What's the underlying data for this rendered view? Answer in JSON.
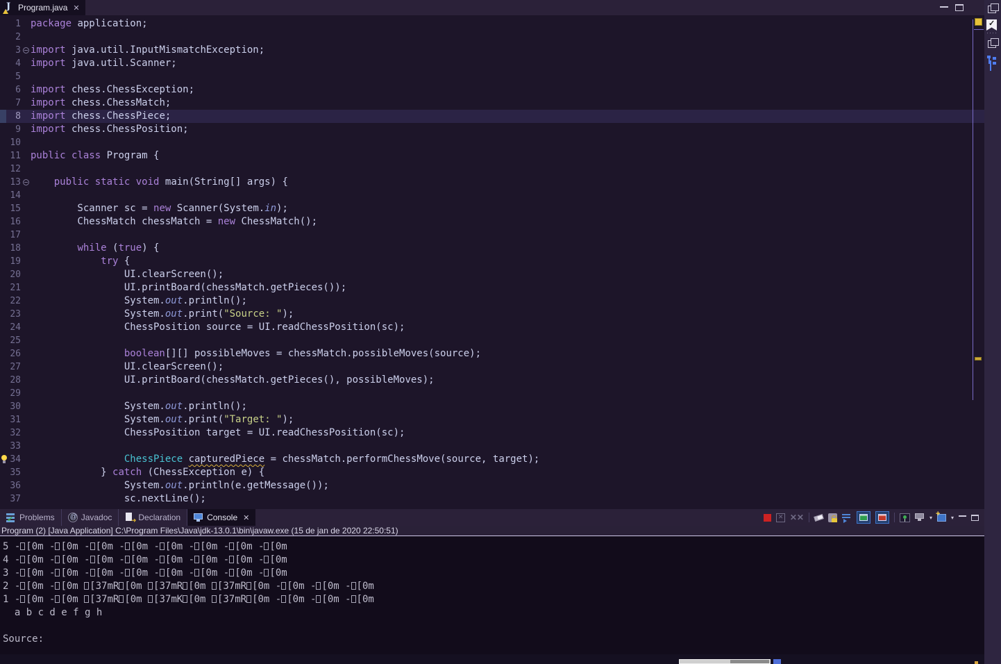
{
  "editor": {
    "tab_title": "Program.java",
    "lines": [
      {
        "n": 1,
        "tokens": [
          [
            "kw",
            "package"
          ],
          [
            "t",
            " application;"
          ]
        ]
      },
      {
        "n": 2,
        "tokens": []
      },
      {
        "n": 3,
        "fold": true,
        "tokens": [
          [
            "kw",
            "import"
          ],
          [
            "t",
            " java.util.InputMismatchException;"
          ]
        ]
      },
      {
        "n": 4,
        "tokens": [
          [
            "kw",
            "import"
          ],
          [
            "t",
            " java.util.Scanner;"
          ]
        ]
      },
      {
        "n": 5,
        "tokens": []
      },
      {
        "n": 6,
        "tokens": [
          [
            "kw",
            "import"
          ],
          [
            "t",
            " chess.ChessException;"
          ]
        ]
      },
      {
        "n": 7,
        "tokens": [
          [
            "kw",
            "import"
          ],
          [
            "t",
            " chess.ChessMatch;"
          ]
        ]
      },
      {
        "n": 8,
        "current": true,
        "tokens": [
          [
            "kw",
            "import"
          ],
          [
            "t",
            " chess.ChessPiece;"
          ]
        ]
      },
      {
        "n": 9,
        "tokens": [
          [
            "kw",
            "import"
          ],
          [
            "t",
            " chess.ChessPosition;"
          ]
        ]
      },
      {
        "n": 10,
        "tokens": []
      },
      {
        "n": 11,
        "tokens": [
          [
            "kw",
            "public"
          ],
          [
            "t",
            " "
          ],
          [
            "kw",
            "class"
          ],
          [
            "t",
            " Program {"
          ]
        ]
      },
      {
        "n": 12,
        "tokens": []
      },
      {
        "n": 13,
        "fold": true,
        "tokens": [
          [
            "t",
            "    "
          ],
          [
            "kw",
            "public"
          ],
          [
            "t",
            " "
          ],
          [
            "kw",
            "static"
          ],
          [
            "t",
            " "
          ],
          [
            "kw",
            "void"
          ],
          [
            "t",
            " main(String[] args) {"
          ]
        ]
      },
      {
        "n": 14,
        "tokens": []
      },
      {
        "n": 15,
        "tokens": [
          [
            "t",
            "        Scanner sc = "
          ],
          [
            "kw",
            "new"
          ],
          [
            "t",
            " Scanner(System."
          ],
          [
            "it",
            "in"
          ],
          [
            "t",
            ");"
          ]
        ]
      },
      {
        "n": 16,
        "tokens": [
          [
            "t",
            "        ChessMatch chessMatch = "
          ],
          [
            "kw",
            "new"
          ],
          [
            "t",
            " ChessMatch();"
          ]
        ]
      },
      {
        "n": 17,
        "tokens": []
      },
      {
        "n": 18,
        "tokens": [
          [
            "t",
            "        "
          ],
          [
            "kw",
            "while"
          ],
          [
            "t",
            " ("
          ],
          [
            "kw",
            "true"
          ],
          [
            "t",
            ") {"
          ]
        ]
      },
      {
        "n": 19,
        "tokens": [
          [
            "t",
            "            "
          ],
          [
            "kw",
            "try"
          ],
          [
            "t",
            " {"
          ]
        ]
      },
      {
        "n": 20,
        "tokens": [
          [
            "t",
            "                UI.clearScreen();"
          ]
        ]
      },
      {
        "n": 21,
        "tokens": [
          [
            "t",
            "                UI.printBoard(chessMatch.getPieces());"
          ]
        ]
      },
      {
        "n": 22,
        "tokens": [
          [
            "t",
            "                System."
          ],
          [
            "it",
            "out"
          ],
          [
            "t",
            ".println();"
          ]
        ]
      },
      {
        "n": 23,
        "tokens": [
          [
            "t",
            "                System."
          ],
          [
            "it",
            "out"
          ],
          [
            "t",
            ".print("
          ],
          [
            "s",
            "\"Source: \""
          ],
          [
            "t",
            ");"
          ]
        ]
      },
      {
        "n": 24,
        "tokens": [
          [
            "t",
            "                ChessPosition source = UI.readChessPosition(sc);"
          ]
        ]
      },
      {
        "n": 25,
        "tokens": []
      },
      {
        "n": 26,
        "tokens": [
          [
            "t",
            "                "
          ],
          [
            "kw",
            "boolean"
          ],
          [
            "t",
            "[][] possibleMoves = chessMatch.possibleMoves(source);"
          ]
        ]
      },
      {
        "n": 27,
        "tokens": [
          [
            "t",
            "                UI.clearScreen();"
          ]
        ]
      },
      {
        "n": 28,
        "tokens": [
          [
            "t",
            "                UI.printBoard(chessMatch.getPieces(), possibleMoves);"
          ]
        ]
      },
      {
        "n": 29,
        "tokens": []
      },
      {
        "n": 30,
        "tokens": [
          [
            "t",
            "                System."
          ],
          [
            "it",
            "out"
          ],
          [
            "t",
            ".println();"
          ]
        ]
      },
      {
        "n": 31,
        "tokens": [
          [
            "t",
            "                System."
          ],
          [
            "it",
            "out"
          ],
          [
            "t",
            ".print("
          ],
          [
            "s",
            "\"Target: \""
          ],
          [
            "t",
            ");"
          ]
        ]
      },
      {
        "n": 32,
        "tokens": [
          [
            "t",
            "                ChessPosition target = UI.readChessPosition(sc);"
          ]
        ]
      },
      {
        "n": 33,
        "tokens": []
      },
      {
        "n": 34,
        "bulb": true,
        "tokens": [
          [
            "t",
            "                "
          ],
          [
            "ty",
            "ChessPiece"
          ],
          [
            "t",
            " "
          ],
          [
            "warn",
            "capturedPiece"
          ],
          [
            "t",
            " = chessMatch.performChessMove(source, target);"
          ]
        ]
      },
      {
        "n": 35,
        "tokens": [
          [
            "t",
            "            } "
          ],
          [
            "kw",
            "catch"
          ],
          [
            "t",
            " (ChessException e) {"
          ]
        ]
      },
      {
        "n": 36,
        "tokens": [
          [
            "t",
            "                System."
          ],
          [
            "it",
            "out"
          ],
          [
            "t",
            ".println(e.getMessage());"
          ]
        ]
      },
      {
        "n": 37,
        "tokens": [
          [
            "t",
            "                sc.nextLine();"
          ]
        ]
      }
    ]
  },
  "panel": {
    "tabs": [
      {
        "label": "Problems"
      },
      {
        "label": "Javadoc"
      },
      {
        "label": "Declaration"
      },
      {
        "label": "Console"
      }
    ]
  },
  "console": {
    "status_line": "Program (2) [Java Application] C:\\Program Files\\Java\\jdk-13.0.1\\bin\\javaw.exe (15 de jan de 2020 22:50:51)",
    "lines": [
      "5 -\u001b[0m -\u001b[0m -\u001b[0m -\u001b[0m -\u001b[0m -\u001b[0m -\u001b[0m -\u001b[0m",
      "4 -\u001b[0m -\u001b[0m -\u001b[0m -\u001b[0m -\u001b[0m -\u001b[0m -\u001b[0m -\u001b[0m",
      "3 -\u001b[0m -\u001b[0m -\u001b[0m -\u001b[0m -\u001b[0m -\u001b[0m -\u001b[0m -\u001b[0m",
      "2 -\u001b[0m -\u001b[0m \u001b[37mR\u001b[0m \u001b[37mR\u001b[0m \u001b[37mR\u001b[0m -\u001b[0m -\u001b[0m -\u001b[0m",
      "1 -\u001b[0m -\u001b[0m \u001b[37mR\u001b[0m \u001b[37mK\u001b[0m \u001b[37mR\u001b[0m -\u001b[0m -\u001b[0m -\u001b[0m",
      "  a b c d e f g h",
      "",
      "Source: "
    ]
  },
  "colors": {
    "keyword": "#ab82d9",
    "string": "#c9d288",
    "static_field": "#8e99d8",
    "type": "#49c3d3",
    "warning_marker": "#e8c23a",
    "terminate_red": "#cc2222",
    "stdout_green": "#2e9e4f",
    "stderr_red": "#c0392b",
    "accent_blue": "#4f86d8",
    "editor_bg": "#1d1529",
    "console_bg": "#120c1b"
  }
}
